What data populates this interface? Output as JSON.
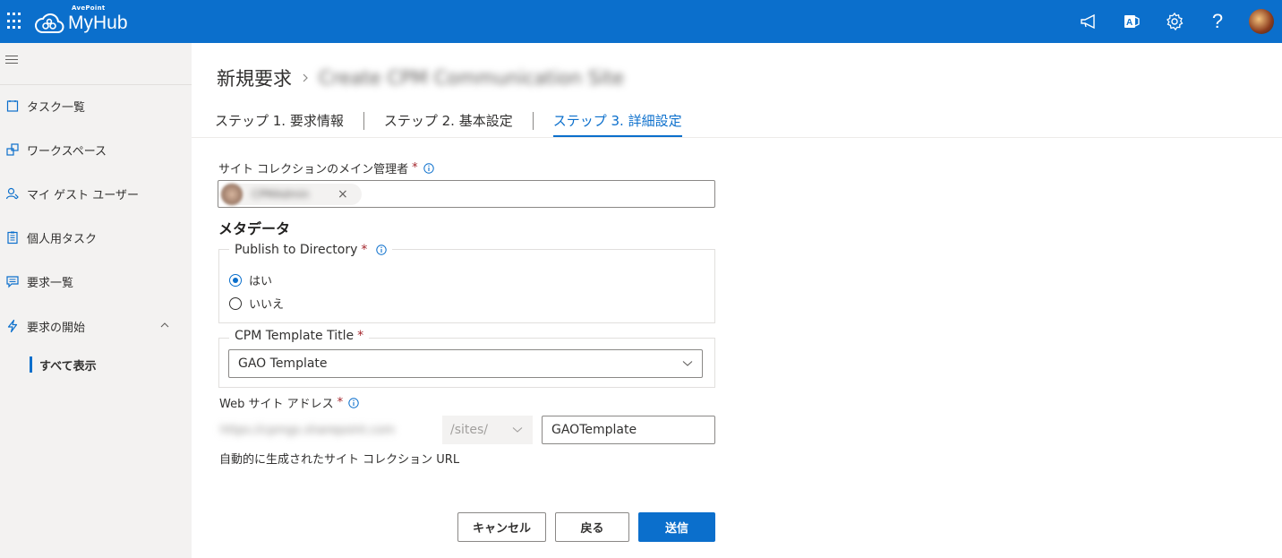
{
  "app": {
    "brand_small": "AvePoint",
    "brand": "MyHub"
  },
  "topbar": {
    "icons": [
      "waffle-icon",
      "megaphone-icon",
      "office-icon",
      "gear-icon",
      "help-icon",
      "avatar"
    ],
    "help_label": "?"
  },
  "sidebar": {
    "items": [
      {
        "label": "タスク一覧",
        "icon": "task-list-icon"
      },
      {
        "label": "ワークスペース",
        "icon": "workspace-icon"
      },
      {
        "label": "マイ ゲスト ユーザー",
        "icon": "guest-user-icon"
      },
      {
        "label": "個人用タスク",
        "icon": "personal-task-icon"
      },
      {
        "label": "要求一覧",
        "icon": "request-list-icon"
      },
      {
        "label": "要求の開始",
        "icon": "lightning-icon",
        "expanded": true
      }
    ],
    "sub_item": "すべて表示"
  },
  "breadcrumb": {
    "root": "新規要求",
    "current": "Create CPM Communication Site"
  },
  "steps": [
    {
      "label": "ステップ 1. 要求情報",
      "active": false
    },
    {
      "label": "ステップ 2. 基本設定",
      "active": false
    },
    {
      "label": "ステップ 3. 詳細設定",
      "active": true
    }
  ],
  "form": {
    "admin_label": "サイト コレクションのメイン管理者",
    "required_mark": "*",
    "admin_chip_name": "CPMAdmin",
    "chip_remove": "×",
    "metadata_heading": "メタデータ",
    "publish_label": "Publish to Directory",
    "publish_options": [
      {
        "label": "はい",
        "selected": true
      },
      {
        "label": "いいえ",
        "selected": false
      }
    ],
    "template_label": "CPM Template Title",
    "template_value": "GAO Template",
    "web_address_label": "Web サイト アドレス",
    "url_prefix": "https://cpmgs.sharepoint.com",
    "url_path": "/sites/",
    "url_value": "GAOTemplate",
    "url_note": "自動的に生成されたサイト コレクション URL"
  },
  "buttons": {
    "cancel": "キャンセル",
    "back": "戻る",
    "submit": "送信"
  },
  "colors": {
    "accent": "#0b6fcc",
    "required": "#a4262c",
    "sidebar_bg": "#f3f2f1"
  }
}
